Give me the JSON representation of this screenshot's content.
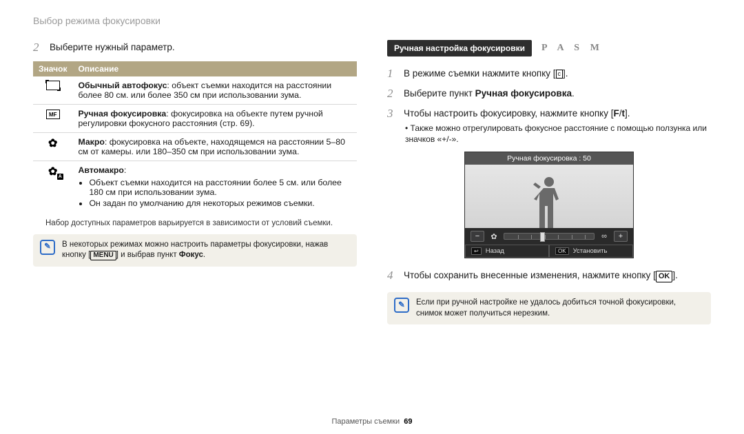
{
  "header": {
    "title": "Выбор режима фокусировки"
  },
  "left": {
    "step2": {
      "num": "2",
      "text": "Выберите нужный параметр."
    },
    "table": {
      "headers": {
        "icon": "Значок",
        "desc": "Описание"
      },
      "rows": [
        {
          "icon_name": "autofocus-icon",
          "title": "Обычный автофокус",
          "desc": ": объект съемки находится на расстоянии более 80 см. или более 350 см при использовании зума."
        },
        {
          "icon_name": "manualfocus-icon",
          "title": "Ручная фокусировка",
          "desc": ": фокусировка на объекте путем ручной регулировки фокусного расстояния (стр. 69)."
        },
        {
          "icon_name": "macro-icon",
          "title": "Макро",
          "desc": ": фокусировка на объекте, находящемся на расстоянии 5–80 см от камеры. или 180–350 см при использовании зума."
        },
        {
          "icon_name": "automacro-icon",
          "title": "Автомакро",
          "bullets": [
            "Объект съемки находится на расстоянии более 5 см. или более 180 см при использовании зума.",
            "Он задан по умолчанию для некоторых режимов съемки."
          ]
        }
      ]
    },
    "footnote": "Набор доступных параметров варьируется в зависимости от условий съемки.",
    "info": {
      "text_a": "В некоторых режимах можно настроить параметры фокусировки, нажав кнопку [",
      "menu_label": "MENU",
      "text_b": "] и выбрав пункт ",
      "focus_word": "Фокус",
      "text_c": "."
    }
  },
  "right": {
    "heading": {
      "bar": "Ручная настройка фокусировки",
      "modes": "P A S M"
    },
    "steps": {
      "s1": {
        "num": "1",
        "text_a": "В режиме съемки нажмите кнопку [",
        "icon_label": "c",
        "text_b": "]."
      },
      "s2": {
        "num": "2",
        "text_a": "Выберите пункт ",
        "bold": "Ручная фокусировка",
        "text_b": "."
      },
      "s3": {
        "num": "3",
        "text_a": "Чтобы настроить фокусировку, нажмите кнопку [",
        "icon_a": "F",
        "sep": "/",
        "icon_b": "t",
        "text_b": "].",
        "sub": "Также можно отрегулировать фокусное расстояние с помощью ползунка или значков «+/-»."
      },
      "s4": {
        "num": "4",
        "text_a": "Чтобы сохранить внесенные изменения, нажмите кнопку [",
        "ok_label": "OK",
        "text_b": "]."
      }
    },
    "preview": {
      "title": "Ручная фокусировка : 50",
      "minus": "−",
      "plus": "+",
      "left_icon": "✿",
      "right_icon": "∞",
      "back_key": "↩",
      "back_label": "Назад",
      "ok_key": "OK",
      "set_label": "Установить"
    },
    "info": {
      "text": "Если при ручной настройке не удалось добиться точной фокусировки, снимок может получиться нерезким."
    }
  },
  "footer": {
    "section": "Параметры съемки",
    "page": "69"
  }
}
